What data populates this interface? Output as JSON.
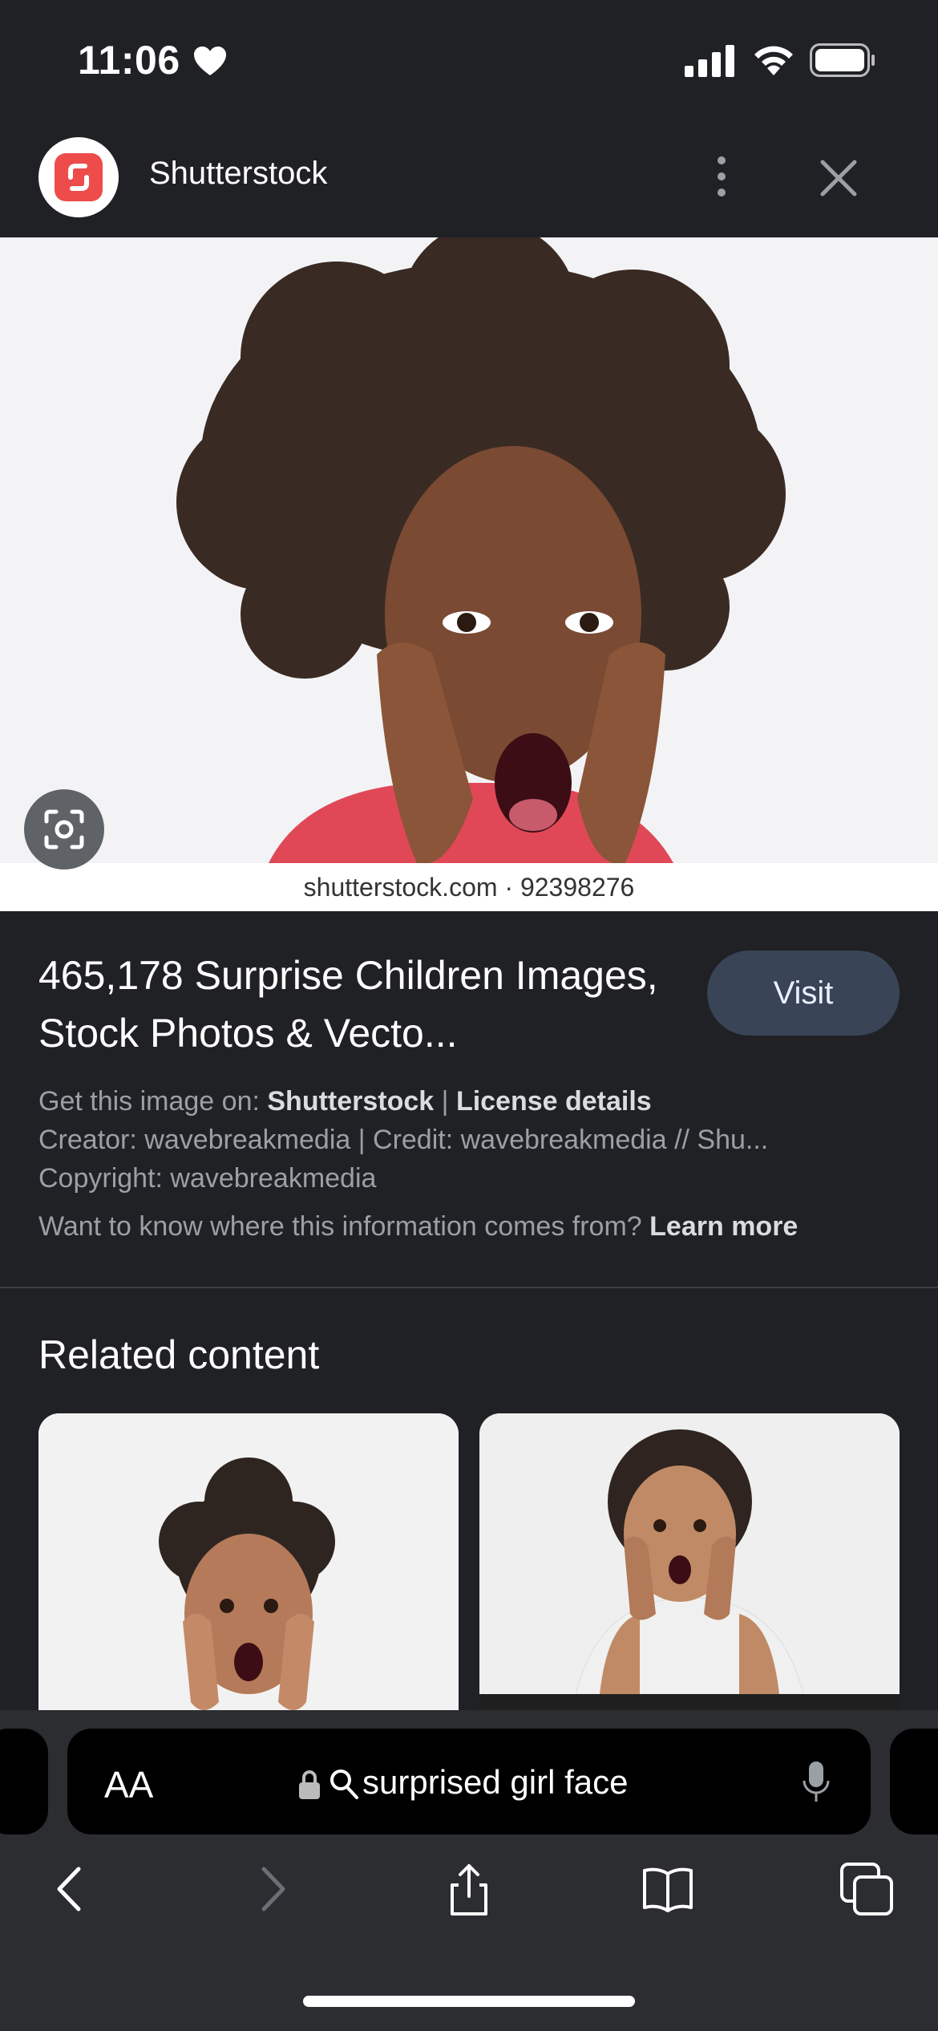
{
  "status_bar": {
    "time": "11:06"
  },
  "header": {
    "site_name": "Shutterstock"
  },
  "image": {
    "watermark": "shutterstock.com · 92398276"
  },
  "result": {
    "title": "465,178 Surprise Children Images, Stock Photos & Vecto...",
    "visit_label": "Visit",
    "source_prefix": "Get this image on: ",
    "source_name": "Shutterstock",
    "separator": " | ",
    "license_label": "License details",
    "creator_line": "Creator: wavebreakmedia | Credit: wavebreakmedia // Shu...",
    "copyright_line": "Copyright: wavebreakmedia",
    "info_question": "Want to know where this information comes from? ",
    "learn_more": "Learn more"
  },
  "related": {
    "heading": "Related content"
  },
  "browser": {
    "aa_label": "AA",
    "url_query": "surprised girl face"
  },
  "colors": {
    "accent_button": "#394457",
    "brand": "#ee4b4b",
    "background": "#202124"
  }
}
